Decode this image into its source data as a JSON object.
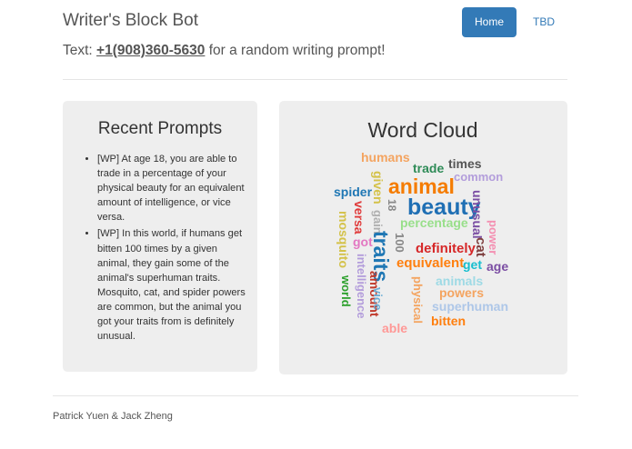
{
  "header": {
    "title": "Writer's Block Bot",
    "subtitle_prefix": "Text: ",
    "phone": "+1(908)360-5630",
    "subtitle_suffix": " for a random writing prompt!"
  },
  "nav": {
    "items": [
      {
        "label": "Home",
        "active": true
      },
      {
        "label": "TBD",
        "active": false
      }
    ]
  },
  "recent_prompts": {
    "title": "Recent Prompts",
    "items": [
      "[WP] At age 18, you are able to trade in a percentage of your physical beauty for an equivalent amount of intelligence, or vice versa.",
      "[WP] In this world, if humans get bitten 100 times by a given animal, they gain some of the animal's superhuman traits. Mosquito, cat, and spider powers are common, but the animal you got your traits from is definitely unusual."
    ]
  },
  "word_cloud": {
    "title": "Word Cloud",
    "words": [
      {
        "text": "humans",
        "color": "#f4a460",
        "rotated": false
      },
      {
        "text": "times",
        "color": "#555555",
        "rotated": false
      },
      {
        "text": "trade",
        "color": "#2e8b57",
        "rotated": false
      },
      {
        "text": "common",
        "color": "#b39ddb",
        "rotated": false
      },
      {
        "text": "given",
        "color": "#d4c24a",
        "rotated": true
      },
      {
        "text": "animal",
        "color": "#f57c00",
        "rotated": false
      },
      {
        "text": "spider",
        "color": "#1f77b4",
        "rotated": false
      },
      {
        "text": "beauty",
        "color": "#1f6fb4",
        "rotated": false
      },
      {
        "text": "unusual",
        "color": "#7b4ea3",
        "rotated": true
      },
      {
        "text": "versa",
        "color": "#e03b3b",
        "rotated": true
      },
      {
        "text": "18",
        "color": "#888888",
        "rotated": true
      },
      {
        "text": "gain",
        "color": "#b0b0b0",
        "rotated": true
      },
      {
        "text": "percentage",
        "color": "#98df8a",
        "rotated": false
      },
      {
        "text": "power",
        "color": "#f48fb1",
        "rotated": true
      },
      {
        "text": "mosquito",
        "color": "#d4c24a",
        "rotated": true
      },
      {
        "text": "got",
        "color": "#e377c2",
        "rotated": false
      },
      {
        "text": "traits",
        "color": "#1f77b4",
        "rotated": true
      },
      {
        "text": "100",
        "color": "#888888",
        "rotated": true
      },
      {
        "text": "definitely",
        "color": "#d62728",
        "rotated": false
      },
      {
        "text": "cat",
        "color": "#7f3f3f",
        "rotated": true
      },
      {
        "text": "intelligence",
        "color": "#b39ddb",
        "rotated": true
      },
      {
        "text": "equivalent",
        "color": "#ff7f0e",
        "rotated": false
      },
      {
        "text": "get",
        "color": "#17becf",
        "rotated": false
      },
      {
        "text": "age",
        "color": "#7b4ea3",
        "rotated": false
      },
      {
        "text": "amount",
        "color": "#c0392b",
        "rotated": true
      },
      {
        "text": "animals",
        "color": "#9edae5",
        "rotated": false
      },
      {
        "text": "world",
        "color": "#2ca02c",
        "rotated": true
      },
      {
        "text": "vice",
        "color": "#6baed6",
        "rotated": true
      },
      {
        "text": "physical",
        "color": "#f4a460",
        "rotated": true
      },
      {
        "text": "powers",
        "color": "#f4a460",
        "rotated": false
      },
      {
        "text": "superhuman",
        "color": "#aec7e8",
        "rotated": false
      },
      {
        "text": "bitten",
        "color": "#ff7f0e",
        "rotated": false
      },
      {
        "text": "able",
        "color": "#ff9896",
        "rotated": false
      }
    ]
  },
  "footer": {
    "credits": "Patrick Yuen & Jack Zheng"
  }
}
